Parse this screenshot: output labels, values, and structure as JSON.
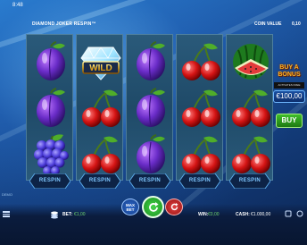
{
  "status_bar": {
    "time": "8:48"
  },
  "header": {
    "game_title": "DIAMOND JOKER RESPIN™",
    "coin_value_label": "COIN VALUE",
    "coin_value": "0,10"
  },
  "reels": {
    "grid": [
      [
        "plum",
        "wild-diamond",
        "plum",
        "cherries",
        "watermelon"
      ],
      [
        "plum",
        "cherries",
        "plum",
        "cherries",
        "cherries"
      ],
      [
        "grapes",
        "cherries",
        "plum",
        "cherries",
        "cherries"
      ]
    ],
    "wild_label": "WILD",
    "respin_labels": [
      "RESPIN",
      "RESPIN",
      "RESPIN",
      "RESPIN",
      "RESPIN"
    ]
  },
  "bonus_panel": {
    "title": "BUY A BONUS",
    "subtitle": "ACTIVATES FREE SPINS",
    "price": "€100,00",
    "buy_label": "BUY"
  },
  "demo_label": "DEMO",
  "bottom_bar": {
    "menu_icon": "hamburger-icon",
    "bet_label": "BET:",
    "bet_value": "€1,00",
    "max_bet_label": "MAX BET",
    "spin_icon": "refresh-icon",
    "autoplay_icon": "autoplay-icon",
    "win_label": "WIN:",
    "win_value": "€0,00",
    "cash_label": "CASH:",
    "cash_value": "€1.000,00"
  },
  "colors": {
    "bet_value": "#6fd36f",
    "respin_text": "#7fc6ff",
    "spin_button": "#1b8f1f",
    "autoplay_button": "#c42a2a",
    "max_bet_button": "#1e4fa8"
  }
}
